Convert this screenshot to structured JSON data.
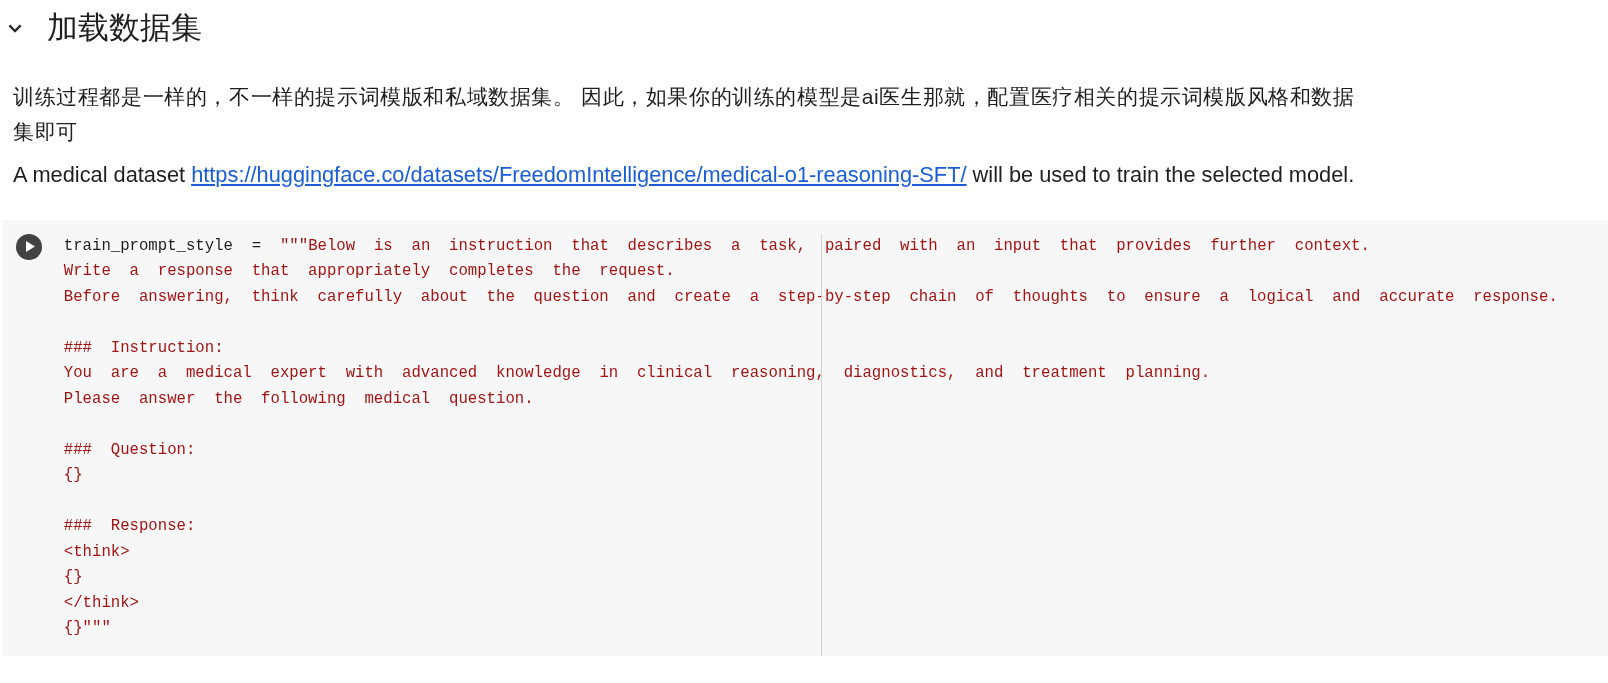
{
  "section": {
    "title": "加载数据集",
    "expanded": true
  },
  "paragraphs": [
    {
      "text": "训练过程都是一样的，不一样的提示词模版和私域数据集。 因此，如果你的训练的模型是ai医生那就，配置医疗相关的提示词模版风格和数据集即可"
    }
  ],
  "dataset_note": {
    "before": "A medical dataset",
    "link": "https://huggingface.co/datasets/FreedomIntelligence/medical-o1-reasoning-SFT/",
    "after": "will be used to train the selected model."
  },
  "code_cell": {
    "lines": [
      {
        "kind": "code",
        "tokens": [
          {
            "kind": "variable",
            "text": "train_prompt_style"
          },
          {
            "kind": "operator",
            "text": "="
          },
          {
            "kind": "string",
            "text": "\"\"\"Below is an instruction that describes a task, paired with an input that provides further context."
          }
        ]
      },
      {
        "kind": "code",
        "tokens": [
          {
            "kind": "string",
            "text": "Write a response that appropriately completes the request."
          }
        ]
      },
      {
        "kind": "code",
        "tokens": [
          {
            "kind": "string",
            "text": "Before answering, think carefully about the question and create a step-by-step chain of thoughts to ensure a logical and accurate response."
          }
        ]
      },
      {
        "kind": "blank"
      },
      {
        "kind": "code",
        "tokens": [
          {
            "kind": "string",
            "text": "### Instruction:"
          }
        ]
      },
      {
        "kind": "code",
        "tokens": [
          {
            "kind": "string",
            "text": "You are a medical expert with advanced knowledge in clinical reasoning, diagnostics, and treatment planning."
          }
        ]
      },
      {
        "kind": "code",
        "tokens": [
          {
            "kind": "string",
            "text": "Please answer the following medical question."
          }
        ]
      },
      {
        "kind": "blank"
      },
      {
        "kind": "code",
        "tokens": [
          {
            "kind": "string",
            "text": "### Question:"
          }
        ]
      },
      {
        "kind": "code",
        "tokens": [
          {
            "kind": "string",
            "text": "{}"
          }
        ]
      },
      {
        "kind": "blank"
      },
      {
        "kind": "code",
        "tokens": [
          {
            "kind": "string",
            "text": "### Response:"
          }
        ]
      },
      {
        "kind": "code",
        "tokens": [
          {
            "kind": "string",
            "text": "<think>"
          }
        ]
      },
      {
        "kind": "code",
        "tokens": [
          {
            "kind": "string",
            "text": "{}"
          }
        ]
      },
      {
        "kind": "code",
        "tokens": [
          {
            "kind": "string",
            "text": "</think>"
          }
        ]
      },
      {
        "kind": "code",
        "tokens": [
          {
            "kind": "string",
            "text": "{}\"\"\""
          }
        ]
      }
    ]
  }
}
